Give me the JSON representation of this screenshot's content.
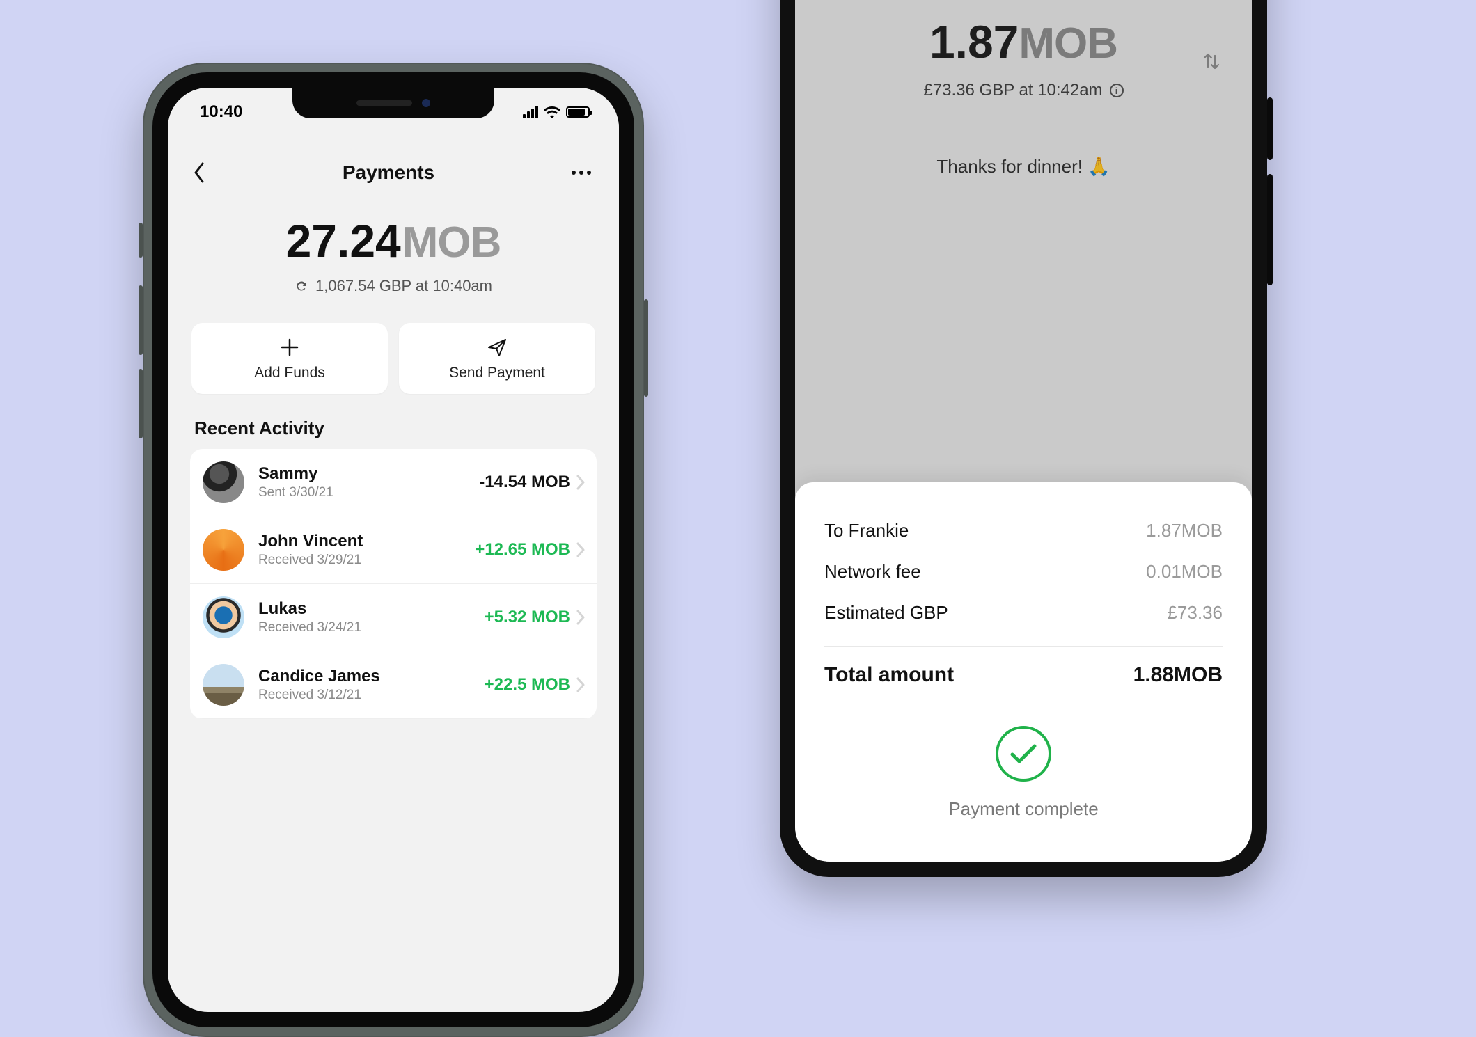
{
  "left": {
    "status_time": "10:40",
    "header": {
      "title": "Payments"
    },
    "balance": {
      "amount": "27.24",
      "currency": "MOB",
      "sub": "1,067.54 GBP at 10:40am"
    },
    "actions": {
      "add_funds": "Add Funds",
      "send_payment": "Send Payment"
    },
    "section_title": "Recent Activity",
    "activity": [
      {
        "name": "Sammy",
        "sub": "Sent 3/30/21",
        "amount": "-14.54 MOB",
        "sign": "neg"
      },
      {
        "name": "John Vincent",
        "sub": "Received 3/29/21",
        "amount": "+12.65 MOB",
        "sign": "pos"
      },
      {
        "name": "Lukas",
        "sub": "Received 3/24/21",
        "amount": "+5.32 MOB",
        "sign": "pos"
      },
      {
        "name": "Candice James",
        "sub": "Received 3/12/21",
        "amount": "+22.5 MOB",
        "sign": "pos"
      }
    ]
  },
  "right": {
    "balance": {
      "amount": "1.87",
      "currency": "MOB"
    },
    "sub": "£73.36 GBP at 10:42am",
    "memo": "Thanks for dinner!",
    "memo_emoji": "🙏",
    "sheet": {
      "rows": [
        {
          "k": "To Frankie",
          "v": "1.87MOB"
        },
        {
          "k": "Network fee",
          "v": "0.01MOB"
        },
        {
          "k": "Estimated GBP",
          "v": "£73.36"
        }
      ],
      "total_k": "Total amount",
      "total_v": "1.88MOB",
      "complete": "Payment complete"
    }
  }
}
